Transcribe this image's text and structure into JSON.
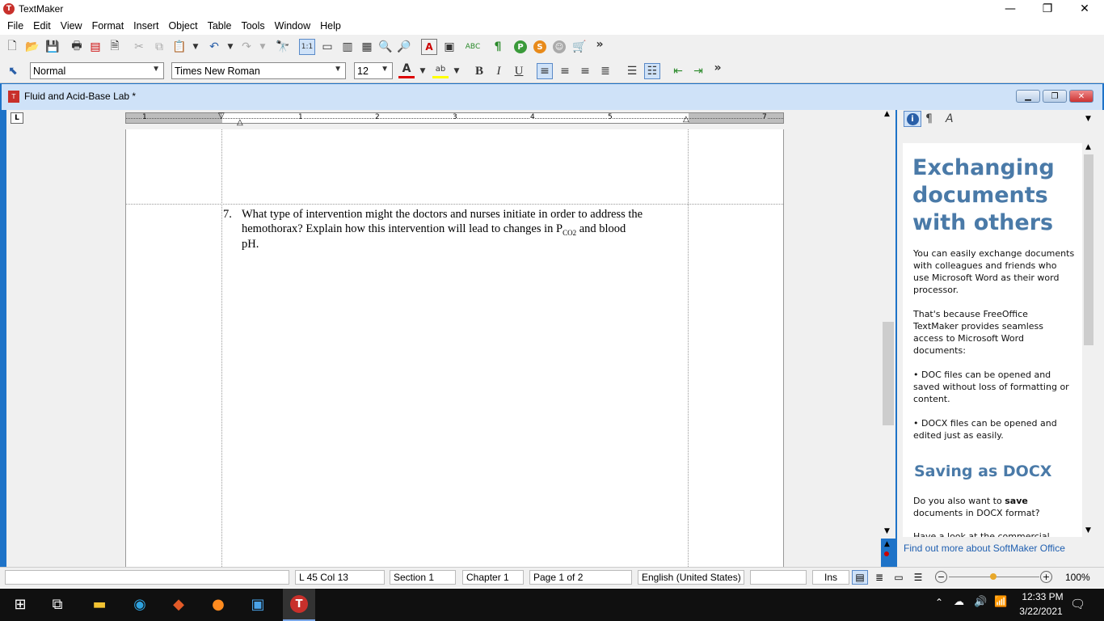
{
  "app": {
    "title": "TextMaker"
  },
  "window_controls": {
    "minimize": "—",
    "restore": "❐",
    "close": "✕"
  },
  "menu": [
    "File",
    "Edit",
    "View",
    "Format",
    "Insert",
    "Object",
    "Table",
    "Tools",
    "Window",
    "Help"
  ],
  "toolbar2": {
    "style": "Normal",
    "font": "Times New Roman",
    "size": "12",
    "more": "»"
  },
  "toolbar1": {
    "more": "»"
  },
  "document": {
    "title": "Fluid and Acid-Base Lab *",
    "ruler_marks": [
      "1",
      "1",
      "2",
      "3",
      "4",
      "5",
      "7"
    ],
    "item_number": "7.",
    "line1": "What type of intervention might the doctors and nurses initiate in order to address the",
    "line2_a": "hemothorax?  Explain how this intervention will lead to changes in P",
    "line2_sub": "CO2",
    "line2_b": " and blood",
    "line3": "pH."
  },
  "sidebar": {
    "heading1": "Exchanging documents with others",
    "p1": "You can easily exchange documents with colleagues and friends who use Microsoft Word as their word processor.",
    "p2": "That's because FreeOffice TextMaker provides seamless access to Microsoft Word documents:",
    "b1": "• DOC files can be opened and saved without loss of formatting or content.",
    "b2": "• DOCX files can be opened and edited just as easily.",
    "heading2": "Saving as DOCX",
    "p3_a": "Do you also want to ",
    "p3_bold": "save",
    "p3_b": " documents in DOCX format?",
    "p4": "Have a look at the commercial",
    "link": "Find out more about SoftMaker Office"
  },
  "status": {
    "position": "L 45 Col 13",
    "section": "Section 1",
    "chapter": "Chapter 1",
    "page": "Page 1 of 2",
    "language": "English (United States)",
    "mode": "Ins",
    "zoom": "100%"
  },
  "taskbar": {
    "time": "12:33 PM",
    "date": "3/22/2021"
  }
}
